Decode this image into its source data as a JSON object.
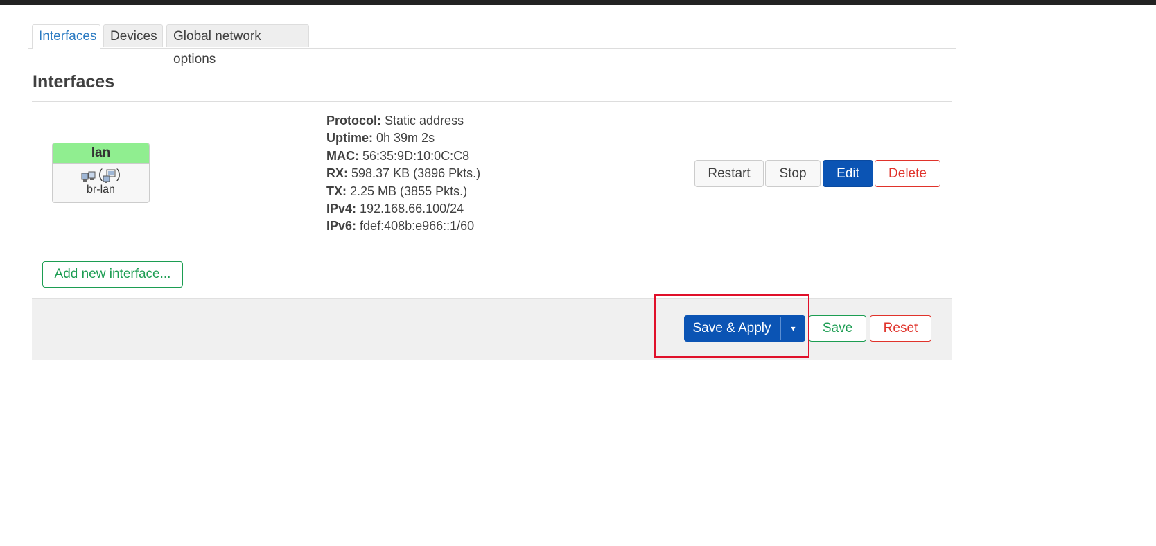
{
  "tabs": [
    {
      "label": "Interfaces",
      "active": true
    },
    {
      "label": "Devices",
      "active": false
    },
    {
      "label": "Global network options",
      "active": false
    }
  ],
  "section_title": "Interfaces",
  "interface": {
    "name": "lan",
    "paren_open": "(",
    "paren_close": ")",
    "device": "br-lan",
    "badge_color": "#90ee90"
  },
  "details": [
    {
      "label": "Protocol:",
      "value": "Static address"
    },
    {
      "label": "Uptime:",
      "value": "0h 39m 2s"
    },
    {
      "label": "MAC:",
      "value": "56:35:9D:10:0C:C8"
    },
    {
      "label": "RX:",
      "value": "598.37 KB (3896 Pkts.)"
    },
    {
      "label": "TX:",
      "value": "2.25 MB (3855 Pkts.)"
    },
    {
      "label": "IPv4:",
      "value": "192.168.66.100/24"
    },
    {
      "label": "IPv6:",
      "value": "fdef:408b:e966::1/60"
    }
  ],
  "row_actions": {
    "restart": "Restart",
    "stop": "Stop",
    "edit": "Edit",
    "delete": "Delete"
  },
  "add_interface_label": "Add new interface...",
  "footer": {
    "save_apply": "Save & Apply",
    "dropdown_glyph": "▾",
    "save": "Save",
    "reset": "Reset"
  },
  "colors": {
    "primary": "#0b54b4",
    "negative": "#e0332b",
    "positive": "#1c9d52",
    "highlight": "#e0102a"
  }
}
